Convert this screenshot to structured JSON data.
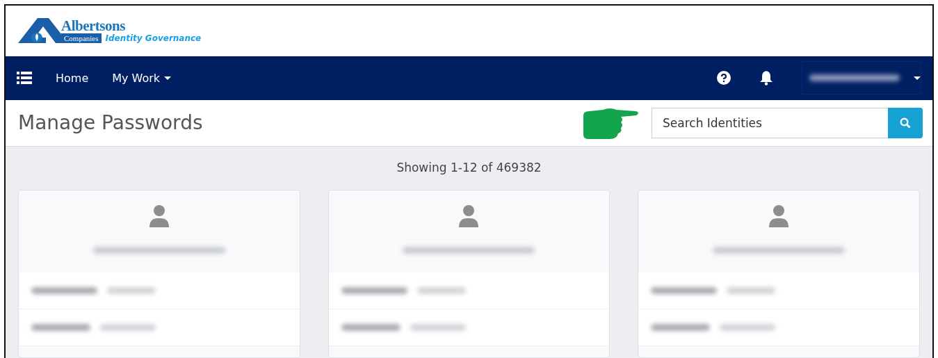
{
  "logo": {
    "brand": "Albertsons",
    "sub": "Companies",
    "product": "Identity Governance"
  },
  "nav": {
    "items": [
      {
        "label": "Home",
        "dropdown": false
      },
      {
        "label": "My Work",
        "dropdown": true
      }
    ],
    "user_redacted": true
  },
  "page": {
    "title": "Manage Passwords",
    "search": {
      "placeholder": "Search Identities"
    },
    "pointer": true
  },
  "results": {
    "summary": "Showing 1-12 of 469382"
  },
  "cards": [
    {
      "redacted": true
    },
    {
      "redacted": true
    },
    {
      "redacted": true
    }
  ]
}
